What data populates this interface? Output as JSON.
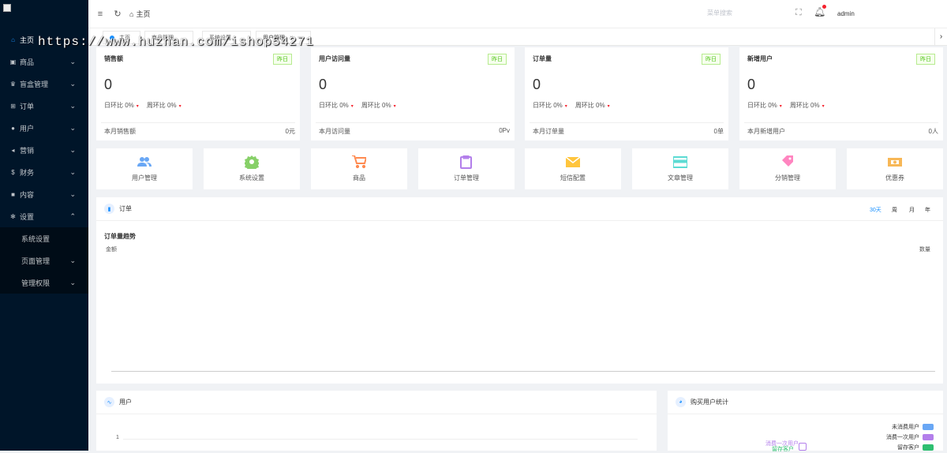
{
  "sidebar": {
    "items": [
      {
        "label": "主页",
        "icon": "home-icon",
        "glyph": "⌂",
        "active": true
      },
      {
        "label": "商品",
        "icon": "goods-icon",
        "glyph": "▣",
        "chevron": "⌄"
      },
      {
        "label": "盲盒管理",
        "icon": "trophy-icon",
        "glyph": "♛",
        "chevron": "⌄"
      },
      {
        "label": "订单",
        "icon": "cart-icon",
        "glyph": "⊞",
        "chevron": "⌄"
      },
      {
        "label": "用户",
        "icon": "user-icon",
        "glyph": "●",
        "chevron": "⌄"
      },
      {
        "label": "营销",
        "icon": "send-icon",
        "glyph": "◂",
        "chevron": "⌄"
      },
      {
        "label": "财务",
        "icon": "dollar-icon",
        "glyph": "$",
        "chevron": "⌄"
      },
      {
        "label": "内容",
        "icon": "book-icon",
        "glyph": "■",
        "chevron": "⌄"
      },
      {
        "label": "设置",
        "icon": "gear-icon",
        "glyph": "✻",
        "chevron": "⌃"
      }
    ],
    "sub": [
      {
        "label": "系统设置"
      },
      {
        "label": "页面管理",
        "chevron": "⌄"
      },
      {
        "label": "管理权限",
        "chevron": "⌄"
      }
    ]
  },
  "topbar": {
    "crumb": "主页",
    "search_placeholder": "菜单搜索",
    "user": "admin"
  },
  "tabs": [
    "主页",
    "商品管理",
    "系统设置",
    "用户管理"
  ],
  "watermark": "https://www.huzhan.com/ishop54271",
  "stats": [
    {
      "title": "销售额",
      "badge": "昨日",
      "value": "0",
      "day": "日环比 0%",
      "week": "周环比 0%",
      "foot": "本月销售额",
      "foot_value": "0元"
    },
    {
      "title": "用户访问量",
      "badge": "昨日",
      "value": "0",
      "day": "日环比 0%",
      "week": "周环比 0%",
      "foot": "本月访问量",
      "foot_value": "0Pv"
    },
    {
      "title": "订单量",
      "badge": "昨日",
      "value": "0",
      "day": "日环比 0%",
      "week": "周环比 0%",
      "foot": "本月订单量",
      "foot_value": "0单"
    },
    {
      "title": "新增用户",
      "badge": "昨日",
      "value": "0",
      "day": "日环比 0%",
      "week": "周环比 0%",
      "foot": "本月新增用户",
      "foot_value": "0人"
    }
  ],
  "arrow": "▾",
  "tiles": [
    {
      "label": "用户管理",
      "color": "#69a7f5",
      "icon": "users-icon"
    },
    {
      "label": "系统设置",
      "color": "#87d068",
      "icon": "settings-icon"
    },
    {
      "label": "商品",
      "color": "#ff8a50",
      "icon": "cart-icon"
    },
    {
      "label": "订单管理",
      "color": "#b37feb",
      "icon": "clipboard-icon"
    },
    {
      "label": "短信配置",
      "color": "#ffc53d",
      "icon": "mail-icon"
    },
    {
      "label": "文章管理",
      "color": "#5cdbd3",
      "icon": "card-icon"
    },
    {
      "label": "分销管理",
      "color": "#ff85c0",
      "icon": "tag-icon"
    },
    {
      "label": "优惠券",
      "color": "#f7b756",
      "icon": "coupon-icon"
    }
  ],
  "order_panel": {
    "title": "订单",
    "periods": [
      "30天",
      "周",
      "月",
      "年"
    ],
    "active_period": "30天",
    "chart_title": "订单量趋势",
    "left_axis": "金额",
    "right_axis": "数量"
  },
  "user_panel": {
    "title": "用户",
    "tick": "1"
  },
  "buy_panel": {
    "title": "购买用户统计",
    "legend": [
      {
        "label": "未消费用户",
        "color": "#69a7f5"
      },
      {
        "label": "消费一次用户",
        "color": "#b37feb"
      },
      {
        "label": "留存客户",
        "color": "#2fbf71"
      }
    ],
    "pie_label1": "消费一次用户",
    "pie_label2": "留存客户"
  }
}
